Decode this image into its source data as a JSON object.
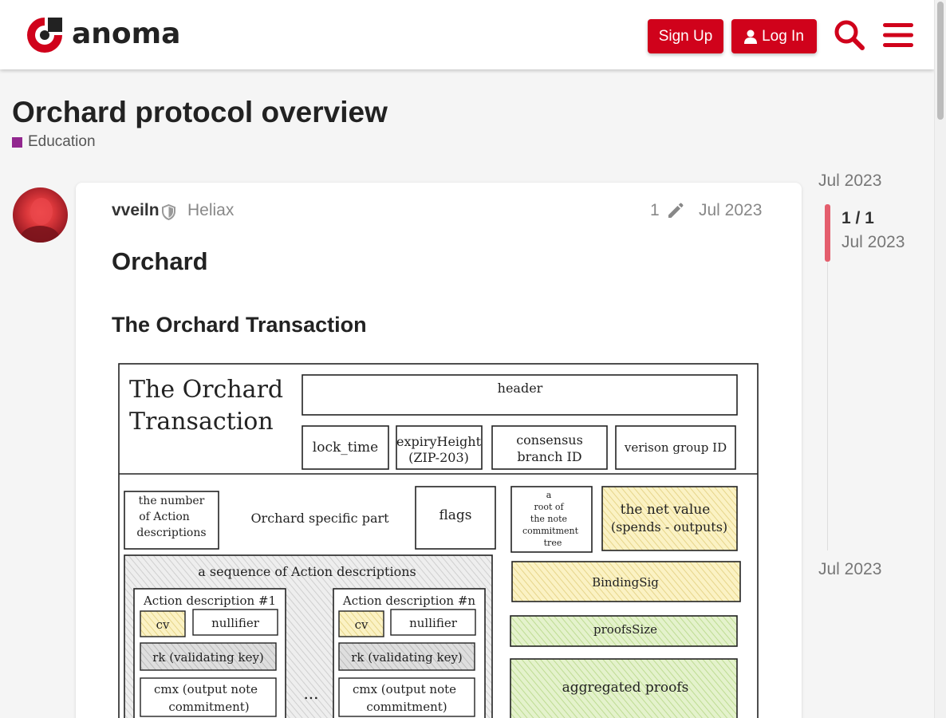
{
  "header": {
    "logo_text": "anoma",
    "signup_label": "Sign Up",
    "login_label": "Log In",
    "brand_color": "#d0021b"
  },
  "topic": {
    "title": "Orchard protocol overview",
    "category": "Education",
    "category_color": "#92278f"
  },
  "post": {
    "username": "vveiln",
    "group": "Heliax",
    "edit_count": "1",
    "date": "Jul 2023",
    "heading1": "Orchard",
    "heading2": "The Orchard Transaction"
  },
  "diagram": {
    "title_line1": "The Orchard",
    "title_line2": "Transaction",
    "header": "header",
    "lock_time": "lock_time",
    "expiry_line1": "expiryHeight",
    "expiry_line2": "(ZIP-203)",
    "consensus_line1": "consensus",
    "consensus_line2": "branch ID",
    "version_group": "verison group ID",
    "num_actions_line1": "the number",
    "num_actions_line2": "of Action",
    "num_actions_line3": "descriptions",
    "orchard_specific": "Orchard specific part",
    "flags": "flags",
    "root_line1": "a",
    "root_line2": "root of",
    "root_line3": "the note",
    "root_line4": "commitment",
    "root_line5": "tree",
    "net_value_line1": "the net value",
    "net_value_line2": "(spends - outputs)",
    "sequence": "a sequence of Action descriptions",
    "action1": "Action description #1",
    "actionn": "Action description #n",
    "cv": "cv",
    "nullifier": "nullifier",
    "rk": "rk (validating key)",
    "cmx_line1": "cmx (output note",
    "cmx_line2": "commitment)",
    "ellipsis": "...",
    "binding_sig": "BindingSig",
    "proofs_size": "proofsSize",
    "aggregated_proofs": "aggregated proofs"
  },
  "timeline": {
    "top_date": "Jul 2023",
    "position": "1 / 1",
    "position_date": "Jul 2023",
    "bottom_date": "Jul 2023"
  }
}
